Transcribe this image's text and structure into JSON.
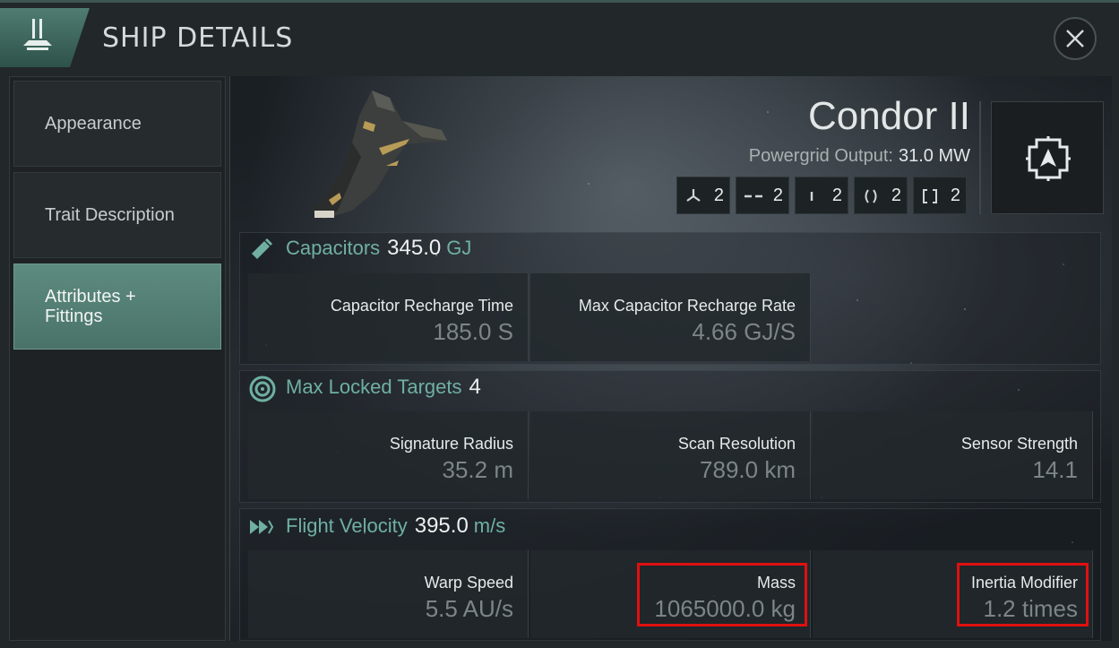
{
  "header": {
    "title": "SHIP DETAILS"
  },
  "sidebar": {
    "items": [
      {
        "label": "Appearance",
        "active": false
      },
      {
        "label": "Trait Description",
        "active": false
      },
      {
        "label": "Attributes + Fittings",
        "active": true
      }
    ]
  },
  "ship": {
    "name": "Condor II",
    "powergrid_label": "Powergrid Output:",
    "powergrid_value": "31.0 MW",
    "slots": [
      {
        "icon": "tri-blade-icon",
        "count": "2"
      },
      {
        "icon": "dash-icon",
        "count": "2"
      },
      {
        "icon": "bar-icon",
        "count": "2"
      },
      {
        "icon": "paren-icon",
        "count": "2"
      },
      {
        "icon": "bracket-icon",
        "count": "2"
      }
    ]
  },
  "sections": {
    "capacitors": {
      "title": "Capacitors",
      "value": "345.0",
      "unit": "GJ",
      "cells": [
        {
          "label": "Capacitor Recharge Time",
          "value": "185.0 S"
        },
        {
          "label": "Max Capacitor Recharge Rate",
          "value": "4.66 GJ/S"
        }
      ]
    },
    "targets": {
      "title": "Max Locked Targets",
      "value": "4",
      "cells": [
        {
          "label": "Signature Radius",
          "value": "35.2 m"
        },
        {
          "label": "Scan Resolution",
          "value": "789.0 km"
        },
        {
          "label": "Sensor Strength",
          "value": "14.1"
        }
      ]
    },
    "velocity": {
      "title": "Flight Velocity",
      "value": "395.0",
      "unit": "m/s",
      "cells": [
        {
          "label": "Warp Speed",
          "value": "5.5 AU/s"
        },
        {
          "label": "Mass",
          "value": "1065000.0 kg"
        },
        {
          "label": "Inertia Modifier",
          "value": "1.2 times"
        }
      ]
    }
  },
  "colors": {
    "accent": "#6fb0a3",
    "active_tab": "#5e8b7f",
    "highlight": "#e01010"
  }
}
